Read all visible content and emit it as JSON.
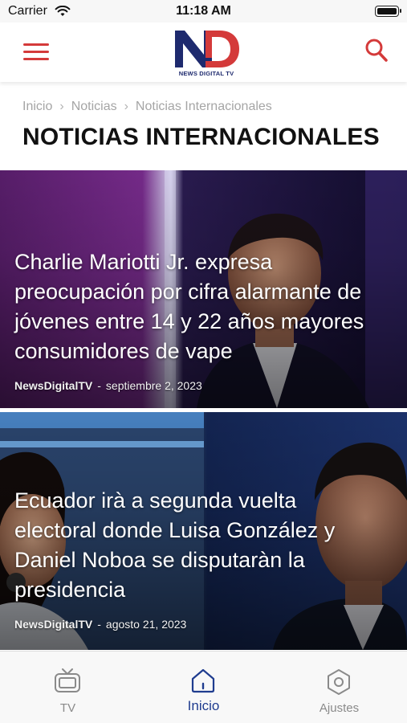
{
  "status_bar": {
    "carrier": "Carrier",
    "time": "11:18 AM",
    "battery_level": 1.0
  },
  "header": {
    "logo_monogram": "ND",
    "logo_text": "NEWS DIGITAL TV",
    "menu_icon": "hamburger-menu-icon",
    "search_icon": "search-icon"
  },
  "breadcrumb": {
    "items": [
      "Inicio",
      "Noticias",
      "Noticias Internacionales"
    ],
    "separator": "›"
  },
  "page_title": "NOTICIAS INTERNACIONALES",
  "articles": [
    {
      "title": "Charlie Mariotti Jr. expresa preocupación por cifra alarmante de jóvenes entre 14 y 22 años mayores consumidores de vape",
      "author": "NewsDigitalTV",
      "separator": "-",
      "date": "septiembre 2, 2023"
    },
    {
      "title": "Ecuador irà a segunda vuelta electoral donde Luisa González y Daniel Noboa se disputaràn la presidencia",
      "author": "NewsDigitalTV",
      "separator": "-",
      "date": "agosto 21, 2023"
    }
  ],
  "tab_bar": {
    "tabs": [
      {
        "label": "TV",
        "icon": "tv-icon",
        "active": false
      },
      {
        "label": "Inicio",
        "icon": "home-icon",
        "active": true
      },
      {
        "label": "Ajustes",
        "icon": "settings-icon",
        "active": false
      }
    ]
  },
  "colors": {
    "brand_red": "#d43a3a",
    "brand_navy": "#1e2a6e",
    "active_tab": "#1f3c8f",
    "inactive_tab": "#8a8a8a"
  }
}
